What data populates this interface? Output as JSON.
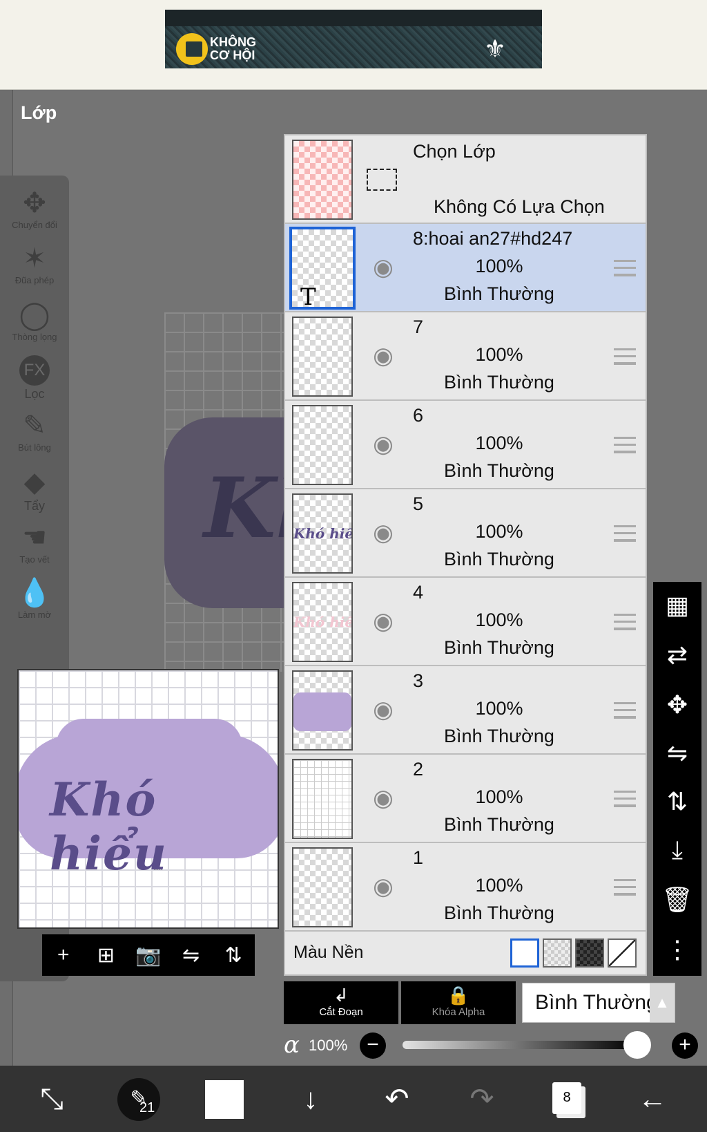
{
  "ad": {
    "line1": "KHÔNG",
    "line2": "CƠ HỘI"
  },
  "panel_title": "Lớp",
  "tools": [
    {
      "icon": "move-icon",
      "label": "Chuyển đổi"
    },
    {
      "icon": "magic-wand-icon",
      "label": "Đũa phép"
    },
    {
      "icon": "lasso-icon",
      "label": "Thòng lọng"
    },
    {
      "icon": "fx-icon",
      "label": "Lọc",
      "glyph": "FX"
    },
    {
      "icon": "pen-icon",
      "label": "Bút lông"
    },
    {
      "icon": "eraser-icon",
      "label": "Tẩy"
    },
    {
      "icon": "smudge-icon",
      "label": "Tạo vết"
    },
    {
      "icon": "blur-icon",
      "label": "Làm mờ"
    }
  ],
  "canvas": {
    "artwork_text": "Khó hiểu"
  },
  "selection_row": {
    "title": "Chọn Lớp",
    "subtitle": "Không Có Lựa Chọn"
  },
  "layers": [
    {
      "name": "8:hoai an27#hd247",
      "opacity": "100%",
      "mode": "Bình Thường",
      "selected": true,
      "text_layer": true,
      "thumb_glyph": "T"
    },
    {
      "name": "7",
      "opacity": "100%",
      "mode": "Bình Thường"
    },
    {
      "name": "6",
      "opacity": "100%",
      "mode": "Bình Thường"
    },
    {
      "name": "5",
      "opacity": "100%",
      "mode": "Bình Thường",
      "thumb_text": "Khó hiểu"
    },
    {
      "name": "4",
      "opacity": "100%",
      "mode": "Bình Thường",
      "thumb_text": "Khó hiểu"
    },
    {
      "name": "3",
      "opacity": "100%",
      "mode": "Bình Thường"
    },
    {
      "name": "2",
      "opacity": "100%",
      "mode": "Bình Thường"
    },
    {
      "name": "1",
      "opacity": "100%",
      "mode": "Bình Thường"
    }
  ],
  "background_row": {
    "label": "Màu Nền"
  },
  "layer_controls": {
    "clip_label": "Cắt Đoạn",
    "alpha_lock_label": "Khóa Alpha",
    "blend_mode": "Bình Thường",
    "opacity_symbol": "α",
    "opacity_value": "100%",
    "opacity_fraction": 1.0
  },
  "bottom_bar": {
    "brush_size": "21",
    "layer_count": "8"
  },
  "colors": {
    "selected_row": "#c9d6ee",
    "selected_border": "#1e63d6",
    "panel_bg": "#e8e8e8"
  }
}
